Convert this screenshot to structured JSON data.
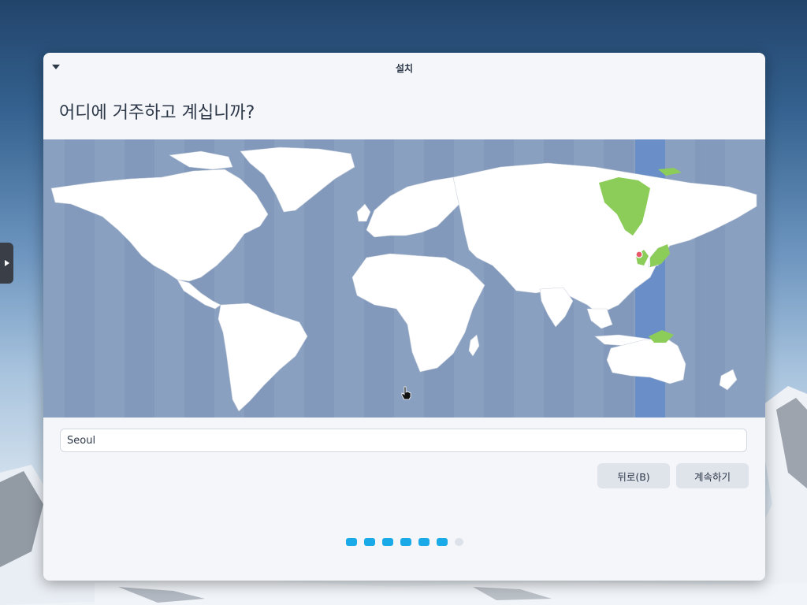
{
  "window": {
    "title": "설치"
  },
  "page": {
    "question": "어디에 거주하고 계십니까?"
  },
  "map": {
    "selected_timezone": "Seoul",
    "colors": {
      "ocean": "#8aa0c0",
      "stripe": "#7a92b6",
      "highlight_band": "#6a8fc8",
      "land": "#ffffff",
      "selected_land": "#8ccd5a",
      "pin": "#e85a6a"
    }
  },
  "location_input": {
    "value": "Seoul"
  },
  "buttons": {
    "back": "뒤로(B)",
    "next": "계속하기"
  },
  "pager": {
    "total": 7,
    "active": 6
  }
}
